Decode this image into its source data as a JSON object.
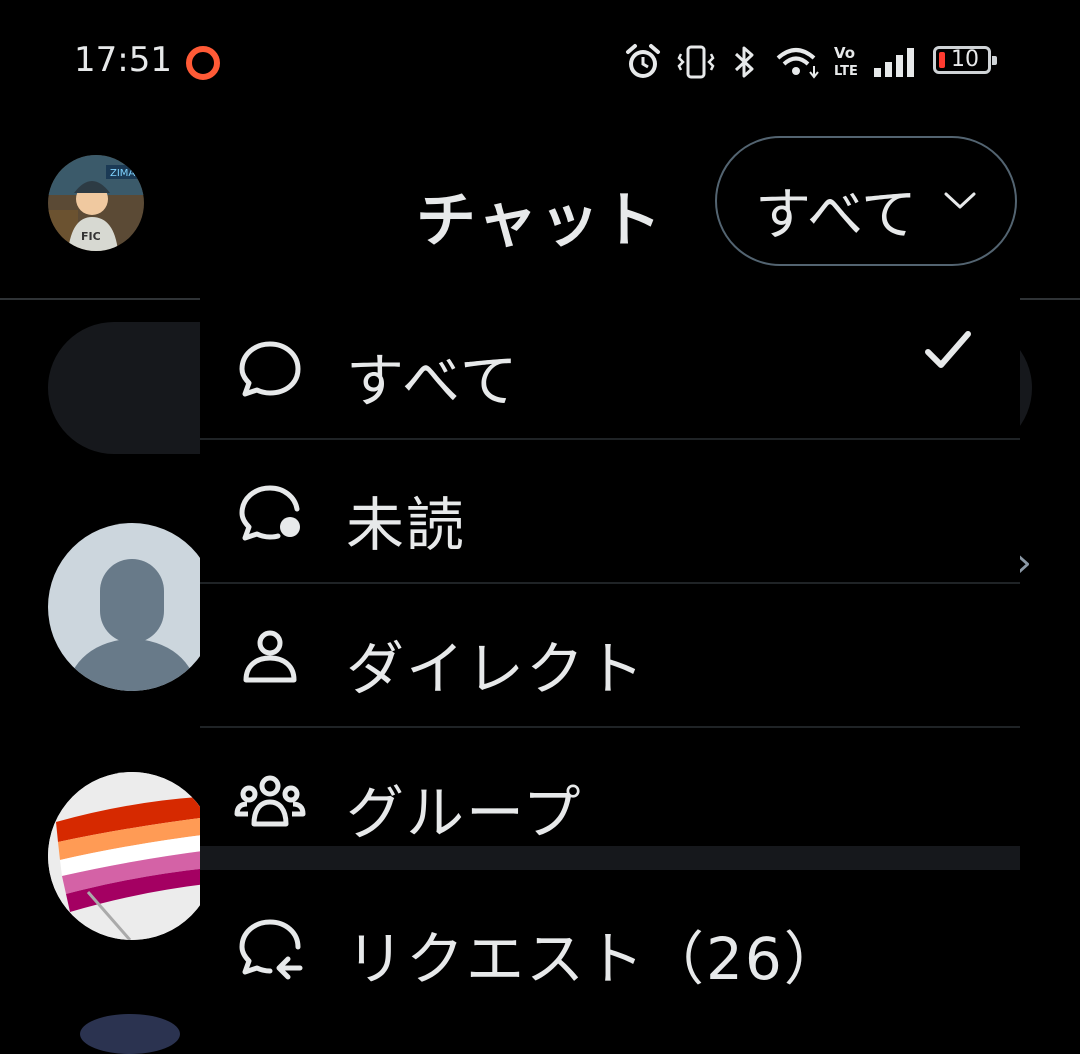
{
  "status_bar": {
    "time": "17:51",
    "battery": "10",
    "volte": "Vo LTE"
  },
  "header": {
    "title": "チャット",
    "filter_label": "すべて",
    "avatar_text": "ZIMA"
  },
  "menu": {
    "items": [
      {
        "label": "すべて",
        "icon": "chat-bubble-icon",
        "selected": true
      },
      {
        "label": "未読",
        "icon": "unread-bubble-icon",
        "selected": false
      },
      {
        "label": "ダイレクト",
        "icon": "person-icon",
        "selected": false
      },
      {
        "label": "グループ",
        "icon": "group-icon",
        "selected": false
      },
      {
        "label": "リクエスト（26）",
        "icon": "request-bubble-icon",
        "selected": false
      }
    ]
  },
  "colors": {
    "background": "#000000",
    "text": "#e7e9ea",
    "separator": "#16181c",
    "recording": "#ff5a36",
    "battery_low": "#ff3b30"
  }
}
